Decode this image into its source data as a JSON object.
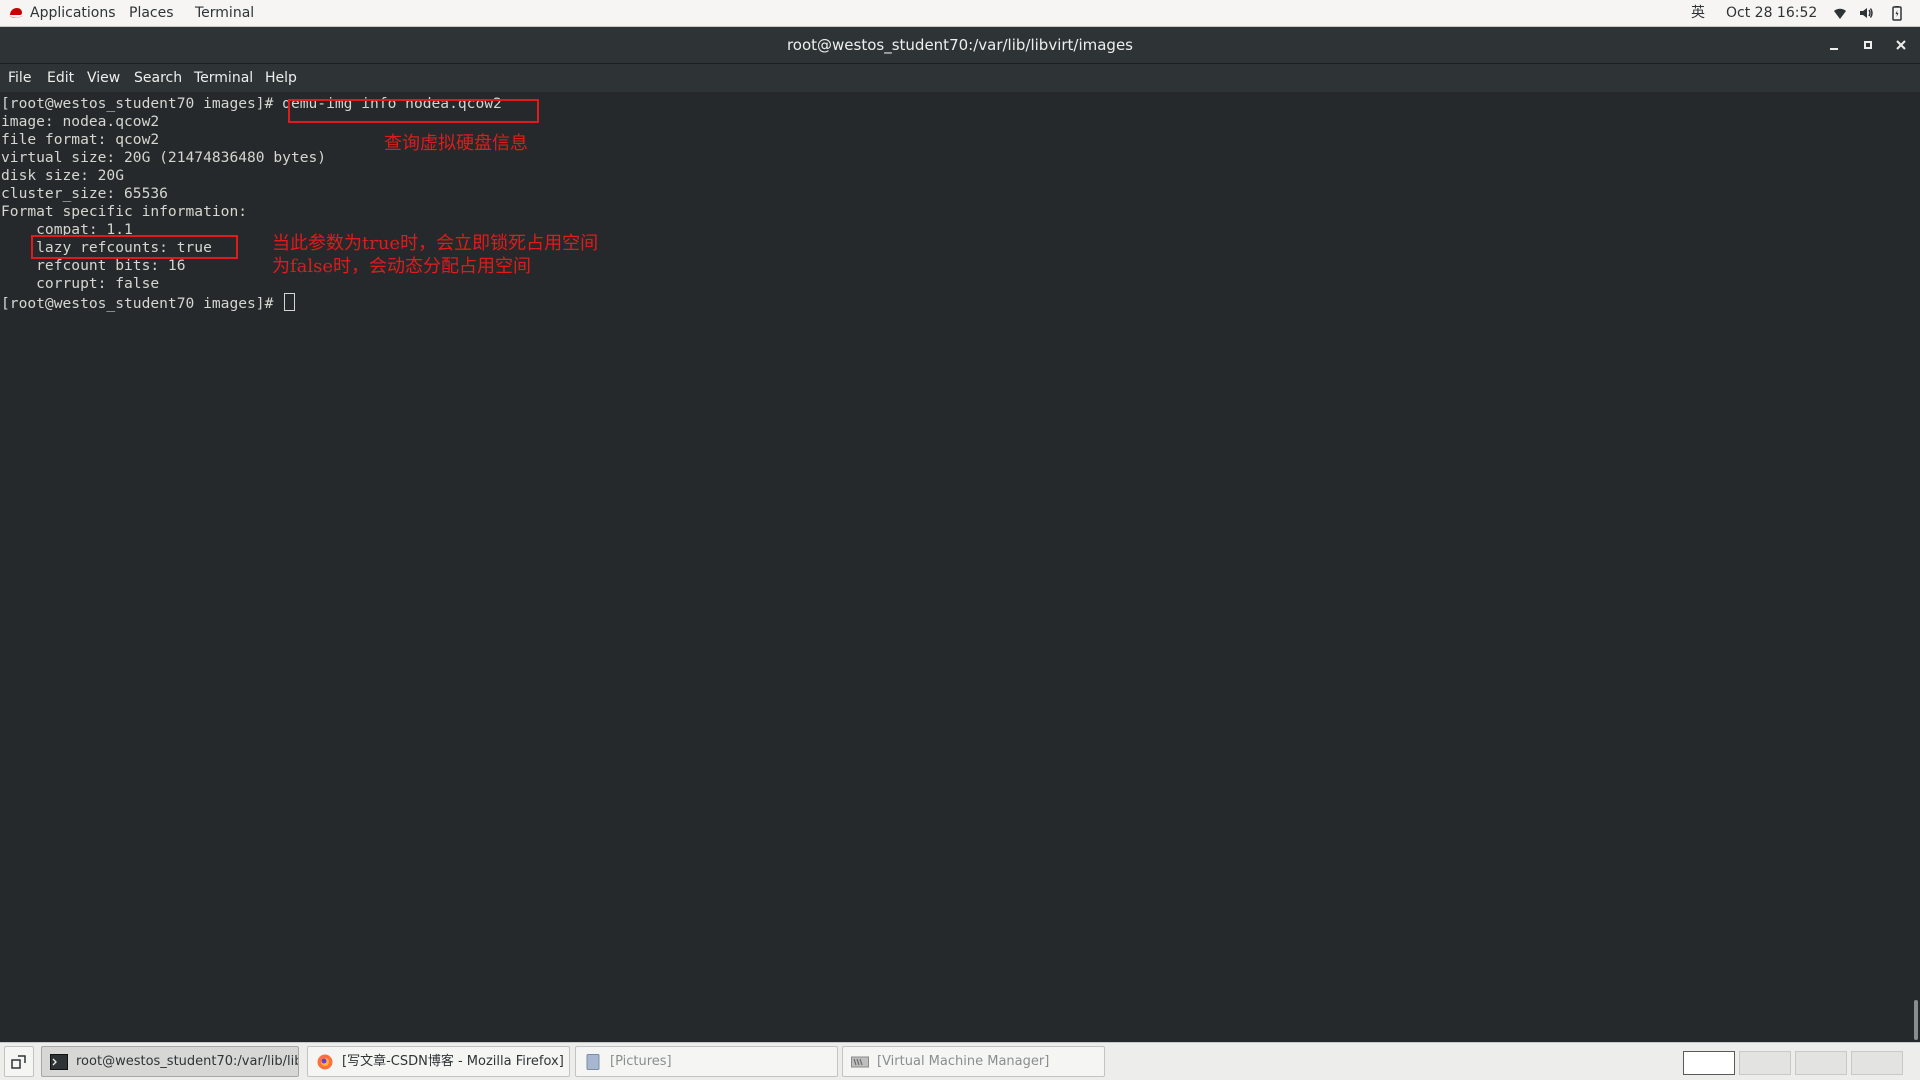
{
  "top_panel": {
    "menus": [
      "Applications",
      "Places",
      "Terminal"
    ],
    "input_method": "英",
    "datetime": "Oct 28  16:52"
  },
  "window": {
    "title": "root@westos_student70:/var/lib/libvirt/images",
    "menu": [
      "File",
      "Edit",
      "View",
      "Search",
      "Terminal",
      "Help"
    ]
  },
  "terminal": {
    "lines": [
      "[root@westos_student70 images]# qemu-img info nodea.qcow2",
      "image: nodea.qcow2",
      "file format: qcow2",
      "virtual size: 20G (21474836480 bytes)",
      "disk size: 20G",
      "cluster_size: 65536",
      "Format specific information:",
      "    compat: 1.1",
      "    lazy refcounts: true",
      "    refcount bits: 16",
      "    corrupt: false"
    ],
    "prompt": "[root@westos_student70 images]# "
  },
  "annotations": {
    "note1": "查询虚拟硬盘信息",
    "note2_line1": "当此参数为true时，会立即锁死占用空间",
    "note2_line2": "为false时，会动态分配占用空间",
    "color": "#e01b1b"
  },
  "taskbar": {
    "tasks": [
      {
        "label": "root@westos_student70:/var/lib/lib...",
        "icon": "terminal-icon"
      },
      {
        "label": "[写文章-CSDN博客 - Mozilla Firefox]",
        "icon": "firefox-icon"
      },
      {
        "label": "[Pictures]",
        "icon": "folder-icon"
      },
      {
        "label": "[Virtual Machine Manager]",
        "icon": "virt-manager-icon"
      }
    ]
  }
}
